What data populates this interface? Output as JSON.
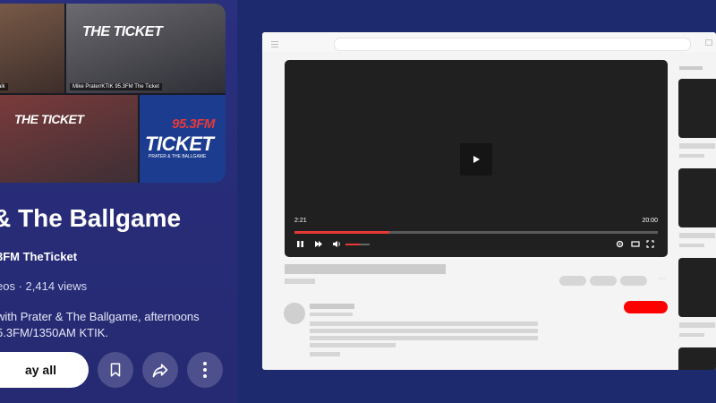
{
  "playlist": {
    "thumbnails": [
      {
        "caption": "Talk"
      },
      {
        "caption": "Mike Prater/KTIK 95.3FM The Ticket",
        "logo_text": "THE TICKET",
        "freq": "95.3"
      },
      {
        "logo_text": "THE TICKET",
        "freq": "95.3"
      },
      {
        "logo_text": "TICKET",
        "freq": "95.3FM",
        "sub": "PRATER & THE BALLGAME"
      }
    ],
    "title": "& The Ballgame",
    "channel": "3FM TheTicket",
    "stats": "eos · 2,414 views",
    "description_line1": "with Prater & The Ballgame, afternoons",
    "description_line2": "5.3FM/1350AM KTIK.",
    "play_all_label": "ay all",
    "icons": [
      "save-icon",
      "share-icon",
      "more-options-icon"
    ]
  },
  "mock_player": {
    "current_time": "2:21",
    "total_time": "20:00",
    "progress": 0.26,
    "volume": 0.6,
    "accent_color": "#e53935"
  },
  "colors": {
    "page_background": "#1e2a6e",
    "panel_background": "#2a2f7e",
    "subscribe_red": "#ff0000"
  }
}
